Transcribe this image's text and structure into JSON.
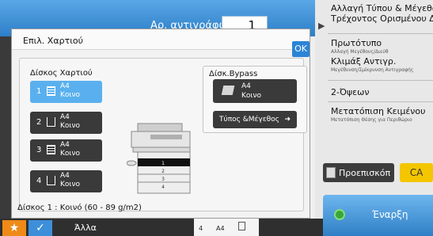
{
  "header": {
    "copies_label": "Αρ. αντιγράφων",
    "copies_value": "1"
  },
  "dialog": {
    "title": "Επιλ. Χαρτιού",
    "ok_label": "OK",
    "tray_section_label": "Δίσκος Χαρτιού",
    "trays": [
      {
        "number": "1",
        "size": "A4",
        "type": "Κοινο",
        "selected": true
      },
      {
        "number": "2",
        "size": "A4",
        "type": "Κοινο",
        "selected": false
      },
      {
        "number": "3",
        "size": "A4",
        "type": "Κοινο",
        "selected": false
      },
      {
        "number": "4",
        "size": "A4",
        "type": "Κοινο",
        "selected": false
      }
    ],
    "bypass": {
      "label": "Δίσκ.Bypass",
      "size": "A4",
      "type": "Κοινο",
      "type_size_label": "Τύπος &Μέγεθος"
    },
    "machine_tray_numbers": [
      "1",
      "2",
      "3",
      "4"
    ],
    "footer": "Δίσκος 1 : Κοινό (60 - 89 g/m2)"
  },
  "right_panel": {
    "items": [
      {
        "title": "Αλλαγή Τύπου & Μέγεθους",
        "subtitle": "Τρέχοντος Ορισμένου Δίσκ"
      },
      {
        "title": "Πρωτότυπο",
        "subtitle": "Αλλαγή Μεγέθους/Διεύθ"
      },
      {
        "title": "Κλιμάξ Αντιγρ.",
        "subtitle": "Μεγέθυνση/Σμίκρυνση Αντιγραφής"
      },
      {
        "title": "2-Όψεων",
        "subtitle": ""
      },
      {
        "title": "Μετατόπιση Κειμένου",
        "subtitle": "Μετατόπιση Θέσης για Περιθώριο"
      }
    ],
    "preview_label": "Προεπισκόπ",
    "ca_label": "CA",
    "start_label": "Έναρξη"
  },
  "bottom": {
    "other_label": "Άλλα",
    "tray_peek": {
      "number": "4",
      "size": "A4"
    }
  },
  "colors": {
    "accent_blue": "#2b84d6",
    "selected_tray": "#5ab0ee",
    "ca_yellow": "#f3c600",
    "favorite_orange": "#ee8a17"
  }
}
